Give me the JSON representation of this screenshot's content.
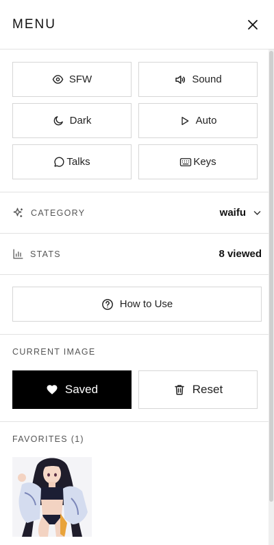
{
  "header": {
    "title": "MENU"
  },
  "toggles": [
    {
      "label": "SFW",
      "icon": "eye-icon"
    },
    {
      "label": "Sound",
      "icon": "speaker-icon"
    },
    {
      "label": "Dark",
      "icon": "moon-icon"
    },
    {
      "label": "Auto",
      "icon": "play-icon"
    },
    {
      "label": "Talks",
      "icon": "chat-bubble-icon"
    },
    {
      "label": "Keys",
      "icon": "keyboard-icon"
    }
  ],
  "category": {
    "label": "CATEGORY",
    "value": "waifu",
    "icon": "sparkle-icon"
  },
  "stats": {
    "label": "STATS",
    "value": "8 viewed",
    "icon": "bar-chart-icon"
  },
  "howto": {
    "label": "How to Use",
    "icon": "question-circle-icon"
  },
  "current_image": {
    "label": "CURRENT IMAGE",
    "saved_label": "Saved",
    "reset_label": "Reset"
  },
  "favorites": {
    "label": "FAVORITES (1)"
  }
}
